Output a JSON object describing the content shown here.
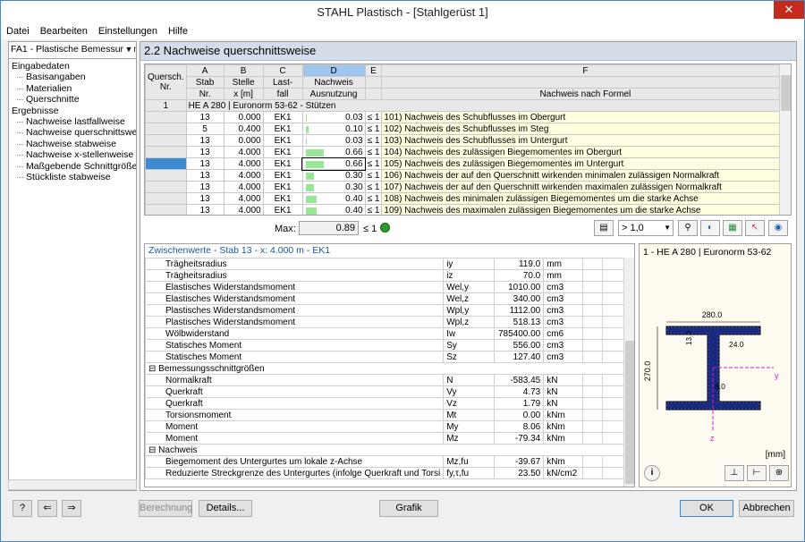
{
  "window": {
    "title": "STAHL Plastisch - [Stahlgerüst 1]",
    "close": "✕"
  },
  "menu": [
    "Datei",
    "Bearbeiten",
    "Einstellungen",
    "Hilfe"
  ],
  "nav": {
    "combo": "FA1 - Plastische Bemessung nac",
    "items": [
      {
        "label": "Eingabedaten",
        "level": 0
      },
      {
        "label": "Basisangaben",
        "level": 1
      },
      {
        "label": "Materialien",
        "level": 1
      },
      {
        "label": "Querschnitte",
        "level": 1
      },
      {
        "label": "Ergebnisse",
        "level": 0
      },
      {
        "label": "Nachweise lastfallweise",
        "level": 1
      },
      {
        "label": "Nachweise querschnittsweise",
        "level": 1
      },
      {
        "label": "Nachweise stabweise",
        "level": 1
      },
      {
        "label": "Nachweise x-stellenweise",
        "level": 1
      },
      {
        "label": "Maßgebende Schnittgrößen sta",
        "level": 1
      },
      {
        "label": "Stückliste stabweise",
        "level": 1
      }
    ]
  },
  "section_title": "2.2 Nachweise querschnittsweise",
  "grid": {
    "letters": [
      "A",
      "B",
      "C",
      "D",
      "E",
      "F"
    ],
    "col0": [
      "Quersch.",
      "Nr."
    ],
    "headers": [
      [
        "Stab",
        "Nr."
      ],
      [
        "Stelle",
        "x [m]"
      ],
      [
        "Last-",
        "fall"
      ],
      [
        "Nachweis",
        "Ausnutzung"
      ],
      [
        "",
        ""
      ],
      [
        "",
        "Nachweis nach Formel"
      ]
    ],
    "group_no": "1",
    "group_label": "HE A 280 | Euronorm 53-62 - Stützen",
    "rows": [
      {
        "stab": "13",
        "x": "0.000",
        "lf": "EK1",
        "eta": "0.03",
        "le": "≤ 1",
        "text": "101) Nachweis des Schubflusses im Obergurt",
        "util": 0.03
      },
      {
        "stab": "5",
        "x": "0.400",
        "lf": "EK1",
        "eta": "0.10",
        "le": "≤ 1",
        "text": "102) Nachweis des Schubflusses im Steg",
        "util": 0.1
      },
      {
        "stab": "13",
        "x": "0.000",
        "lf": "EK1",
        "eta": "0.03",
        "le": "≤ 1",
        "text": "103) Nachweis des Schubflusses im Untergurt",
        "util": 0.03
      },
      {
        "stab": "13",
        "x": "4.000",
        "lf": "EK1",
        "eta": "0.66",
        "le": "≤ 1",
        "text": "104) Nachweis des zulässigen Biegemomentes im Obergurt",
        "util": 0.66
      },
      {
        "stab": "13",
        "x": "4.000",
        "lf": "EK1",
        "eta": "0.66",
        "le": "≤ 1",
        "text": "105) Nachweis des zulässigen Biegemomentes im Untergurt",
        "util": 0.66
      },
      {
        "stab": "13",
        "x": "4.000",
        "lf": "EK1",
        "eta": "0.30",
        "le": "≤ 1",
        "text": "106) Nachweis der auf den Querschnitt wirkenden minimalen zulässigen Normalkraft",
        "util": 0.3
      },
      {
        "stab": "13",
        "x": "4.000",
        "lf": "EK1",
        "eta": "0.30",
        "le": "≤ 1",
        "text": "107) Nachweis der auf den Querschnitt wirkenden maximalen zulässigen Normalkraft",
        "util": 0.3
      },
      {
        "stab": "13",
        "x": "4.000",
        "lf": "EK1",
        "eta": "0.40",
        "le": "≤ 1",
        "text": "108) Nachweis des minimalen zulässigen Biegemomentes um die starke Achse",
        "util": 0.4
      },
      {
        "stab": "13",
        "x": "4.000",
        "lf": "EK1",
        "eta": "0.40",
        "le": "≤ 1",
        "text": "109) Nachweis des maximalen zulässigen Biegemomentes um die starke Achse",
        "util": 0.4
      }
    ],
    "max_label": "Max:",
    "max_value": "0.89",
    "max_le": "≤ 1",
    "filter_value": "> 1,0"
  },
  "intermediate": {
    "title": "Zwischenwerte - Stab 13 - x: 4.000 m - EK1",
    "rows": [
      {
        "type": "item",
        "name": "Trägheitsradius",
        "sym": "iy",
        "val": "119.0",
        "unit": "mm"
      },
      {
        "type": "item",
        "name": "Trägheitsradius",
        "sym": "iz",
        "val": "70.0",
        "unit": "mm"
      },
      {
        "type": "item",
        "name": "Elastisches Widerstandsmoment",
        "sym": "Wel,y",
        "val": "1010.00",
        "unit": "cm3"
      },
      {
        "type": "item",
        "name": "Elastisches Widerstandsmoment",
        "sym": "Wel,z",
        "val": "340.00",
        "unit": "cm3"
      },
      {
        "type": "item",
        "name": "Plastisches Widerstandsmoment",
        "sym": "Wpl,y",
        "val": "1112.00",
        "unit": "cm3"
      },
      {
        "type": "item",
        "name": "Plastisches Widerstandsmoment",
        "sym": "Wpl,z",
        "val": "518.13",
        "unit": "cm3"
      },
      {
        "type": "item",
        "name": "Wölbwiderstand",
        "sym": "Iw",
        "val": "785400.00",
        "unit": "cm6"
      },
      {
        "type": "item",
        "name": "Statisches Moment",
        "sym": "Sy",
        "val": "556.00",
        "unit": "cm3"
      },
      {
        "type": "item",
        "name": "Statisches Moment",
        "sym": "Sz",
        "val": "127.40",
        "unit": "cm3"
      },
      {
        "type": "group",
        "name": "Bemessungsschnittgrößen"
      },
      {
        "type": "item",
        "name": "Normalkraft",
        "sym": "N",
        "val": "-583.45",
        "unit": "kN"
      },
      {
        "type": "item",
        "name": "Querkraft",
        "sym": "Vy",
        "val": "4.73",
        "unit": "kN"
      },
      {
        "type": "item",
        "name": "Querkraft",
        "sym": "Vz",
        "val": "1.79",
        "unit": "kN"
      },
      {
        "type": "item",
        "name": "Torsionsmoment",
        "sym": "Mt",
        "val": "0.00",
        "unit": "kNm"
      },
      {
        "type": "item",
        "name": "Moment",
        "sym": "My",
        "val": "8.06",
        "unit": "kNm"
      },
      {
        "type": "item",
        "name": "Moment",
        "sym": "Mz",
        "val": "-79.34",
        "unit": "kNm"
      },
      {
        "type": "group",
        "name": "Nachweis"
      },
      {
        "type": "item",
        "name": "Biegemoment des Untergurtes um lokale z-Achse",
        "sym": "Mz,fu",
        "val": "-39.67",
        "unit": "kNm"
      },
      {
        "type": "item",
        "name": "Reduzierte Streckgrenze des Untergurtes (infolge Querkraft und Torsi",
        "sym": "fy,τ,fu",
        "val": "23.50",
        "unit": "kN/cm2"
      }
    ]
  },
  "xsection": {
    "title": "1 - HE A 280 | Euronorm 53-62",
    "dim_width": "280.0",
    "dim_height": "270.0",
    "dim_flange": "13.0",
    "dim_radius": "24.0",
    "dim_web": "8.0",
    "axis_y": "y",
    "axis_z": "z",
    "unit": "[mm]"
  },
  "buttons": {
    "calc": "Berechnung",
    "details": "Details...",
    "graphic": "Grafik",
    "ok": "OK",
    "cancel": "Abbrechen"
  }
}
